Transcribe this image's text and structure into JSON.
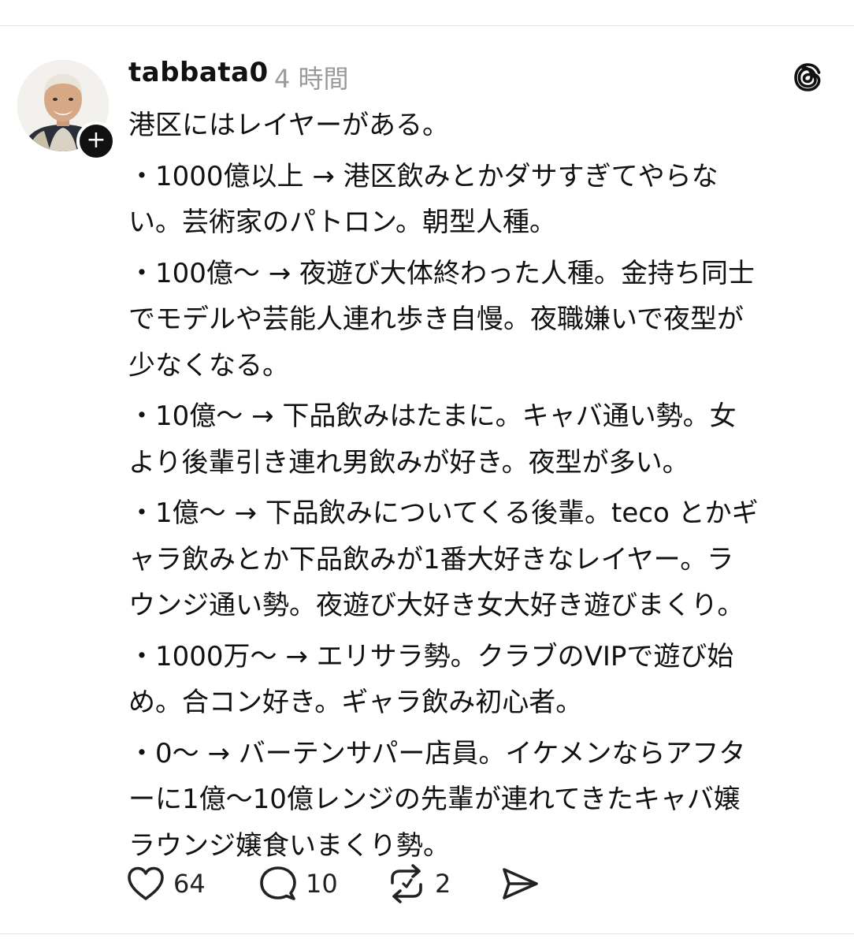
{
  "post": {
    "username": "tabbata0",
    "timestamp": "4 時間",
    "lines": [
      "港区にはレイヤーがある。",
      "・1000億以上 → 港区飲みとかダサすぎてやらな",
      "い。芸術家のパトロン。朝型人種。",
      "・100億〜 → 夜遊び大体終わった人種。金持ち同士",
      "でモデルや芸能人連れ歩き自慢。夜職嫌いで夜型が",
      "少なくなる。",
      "・10億〜 → 下品飲みはたまに。キャバ通い勢。女",
      "より後輩引き連れ男飲みが好き。夜型が多い。",
      "・1億〜 → 下品飲みについてくる後輩。teco とかギ",
      "ャラ飲みとか下品飲みが1番大好きなレイヤー。ラ",
      "ウンジ通い勢。夜遊び大好き女大好き遊びまくり。",
      "・1000万〜 → エリサラ勢。クラブのVIPで遊び始",
      "め。合コン好き。ギャラ飲み初心者。",
      "・0〜 → バーテンサパー店員。イケメンならアフタ",
      "ーに1億〜10億レンジの先輩が連れてきたキャバ嬢",
      "ラウンジ嬢食いまくり勢。"
    ]
  },
  "actions": {
    "likes": "64",
    "replies": "10",
    "reposts": "2"
  },
  "icons": {
    "follow": "plus-icon",
    "app": "threads-logo-icon",
    "like": "heart-icon",
    "reply": "comment-icon",
    "repost": "repost-icon",
    "share": "send-icon"
  },
  "colors": {
    "text": "#111111",
    "muted": "#9a9a9a",
    "divider": "#e4e4e4"
  }
}
